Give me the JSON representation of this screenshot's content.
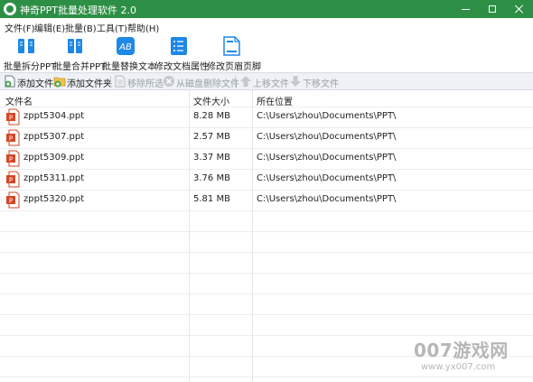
{
  "window": {
    "title": "神奇PPT批量处理软件 2.0",
    "icons": {
      "app": "app-logo-icon",
      "minimize": "minimize-icon",
      "maximize": "maximize-icon",
      "close": "close-icon"
    }
  },
  "menu": [
    "文件(F)",
    "编辑(E)",
    "批量(B)",
    "工具(T)",
    "帮助(H)"
  ],
  "toolbar": [
    {
      "label": "批量拆分PPT",
      "icon": "split-ppt-icon"
    },
    {
      "label": "批量合并PPT",
      "icon": "merge-ppt-icon"
    },
    {
      "label": "批量替换文本",
      "icon": "replace-text-icon"
    },
    {
      "label": "修改文档属性",
      "icon": "document-properties-icon"
    },
    {
      "label": "修改页眉页脚",
      "icon": "header-footer-icon"
    }
  ],
  "actions": [
    {
      "label": "添加文件",
      "icon": "add-file-icon",
      "enabled": true
    },
    {
      "label": "添加文件夹",
      "icon": "add-folder-icon",
      "enabled": true
    },
    {
      "label": "移除所选",
      "icon": "remove-selected-icon",
      "enabled": false
    },
    {
      "label": "从磁盘删除文件",
      "icon": "delete-from-disk-icon",
      "enabled": false
    },
    {
      "label": "上移文件",
      "icon": "move-up-icon",
      "enabled": false
    },
    {
      "label": "下移文件",
      "icon": "move-down-icon",
      "enabled": false
    }
  ],
  "table": {
    "columns": [
      "文件名",
      "文件大小",
      "所在位置"
    ],
    "rows": [
      {
        "name": "zppt5304.ppt",
        "size": "8.28 MB",
        "path": "C:\\Users\\zhou\\Documents\\PPT\\"
      },
      {
        "name": "zppt5307.ppt",
        "size": "2.57 MB",
        "path": "C:\\Users\\zhou\\Documents\\PPT\\"
      },
      {
        "name": "zppt5309.ppt",
        "size": "3.37 MB",
        "path": "C:\\Users\\zhou\\Documents\\PPT\\"
      },
      {
        "name": "zppt5311.ppt",
        "size": "3.76 MB",
        "path": "C:\\Users\\zhou\\Documents\\PPT\\"
      },
      {
        "name": "zppt5320.ppt",
        "size": "5.81 MB",
        "path": "C:\\Users\\zhou\\Documents\\PPT\\"
      }
    ]
  },
  "watermark": {
    "main": "007游戏网",
    "sub": "www.yx007.com"
  },
  "colors": {
    "titlebar": "#2d8f45",
    "toolbar_icon": "#1e88e5",
    "ppt_icon": "#d24726",
    "disabled_text": "#9aa0a6"
  }
}
